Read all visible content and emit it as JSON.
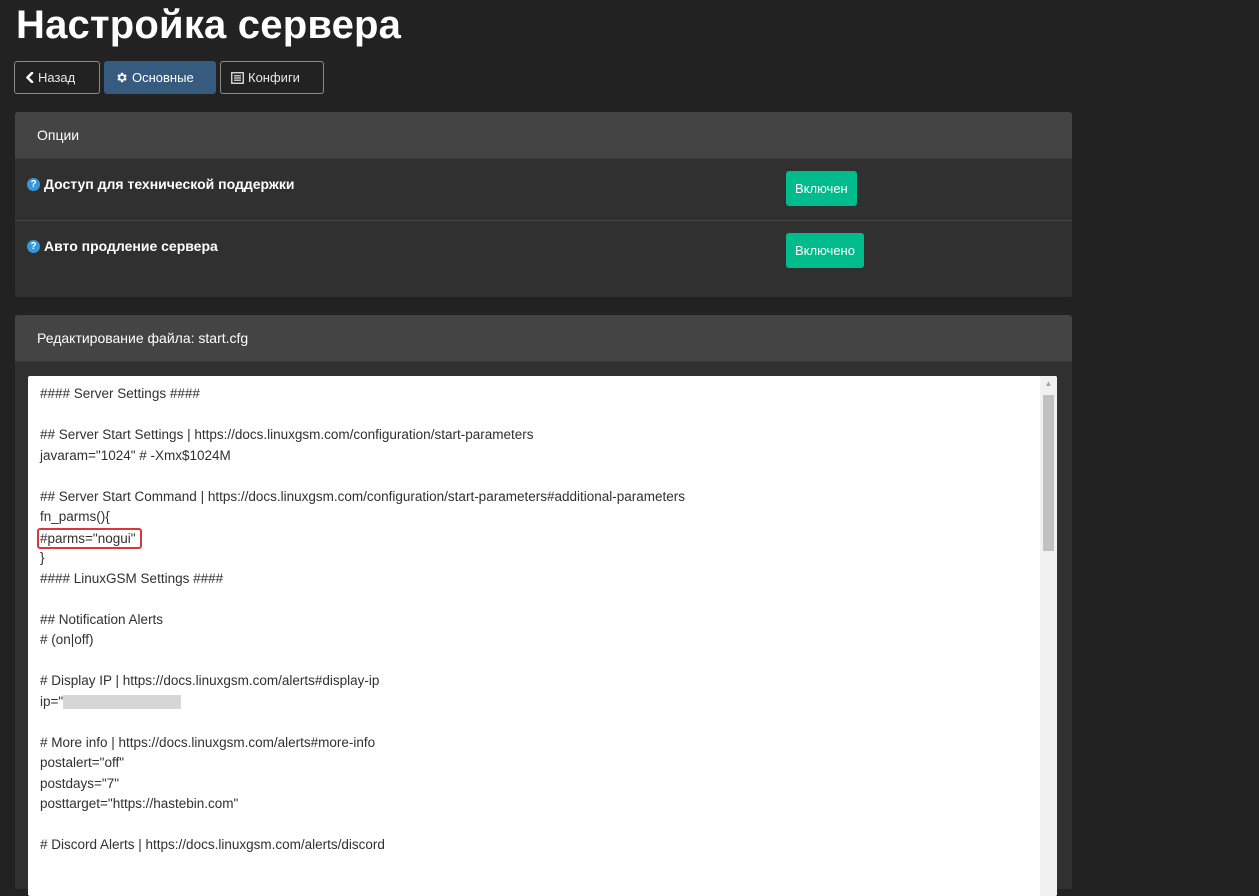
{
  "page": {
    "title": "Настройка сервера"
  },
  "nav": {
    "back_label": "Назад",
    "main_label": "Основные",
    "configs_label": "Конфиги"
  },
  "options_panel": {
    "heading": "Опции",
    "items": [
      {
        "label": "Доступ для технической поддержки",
        "status": "Включен"
      },
      {
        "label": "Авто продление сервера",
        "status": "Включено"
      }
    ]
  },
  "editor_panel": {
    "heading": "Редактирование файла: start.cfg",
    "lines": [
      "#### Server Settings ####",
      "",
      "## Server Start Settings | https://docs.linuxgsm.com/configuration/start-parameters",
      "javaram=\"1024\" # -Xmx$1024M",
      "",
      "## Server Start Command | https://docs.linuxgsm.com/configuration/start-parameters#additional-parameters",
      "fn_parms(){",
      "#parms=\"nogui\"",
      "}",
      "#### LinuxGSM Settings ####",
      "",
      "## Notification Alerts",
      "# (on|off)",
      "",
      "# Display IP | https://docs.linuxgsm.com/alerts#display-ip",
      "ip=\"",
      "",
      "# More info | https://docs.linuxgsm.com/alerts#more-info",
      "postalert=\"off\"",
      "postdays=\"7\"",
      "posttarget=\"https://hastebin.com\"",
      "",
      "# Discord Alerts | https://docs.linuxgsm.com/alerts/discord"
    ]
  },
  "colors": {
    "background": "#222222",
    "panel": "#303030",
    "panel_heading": "#444444",
    "accent_active": "#375a7f",
    "success": "#00bc8c",
    "help_icon": "#3498db",
    "highlight_border": "#d9363e"
  }
}
